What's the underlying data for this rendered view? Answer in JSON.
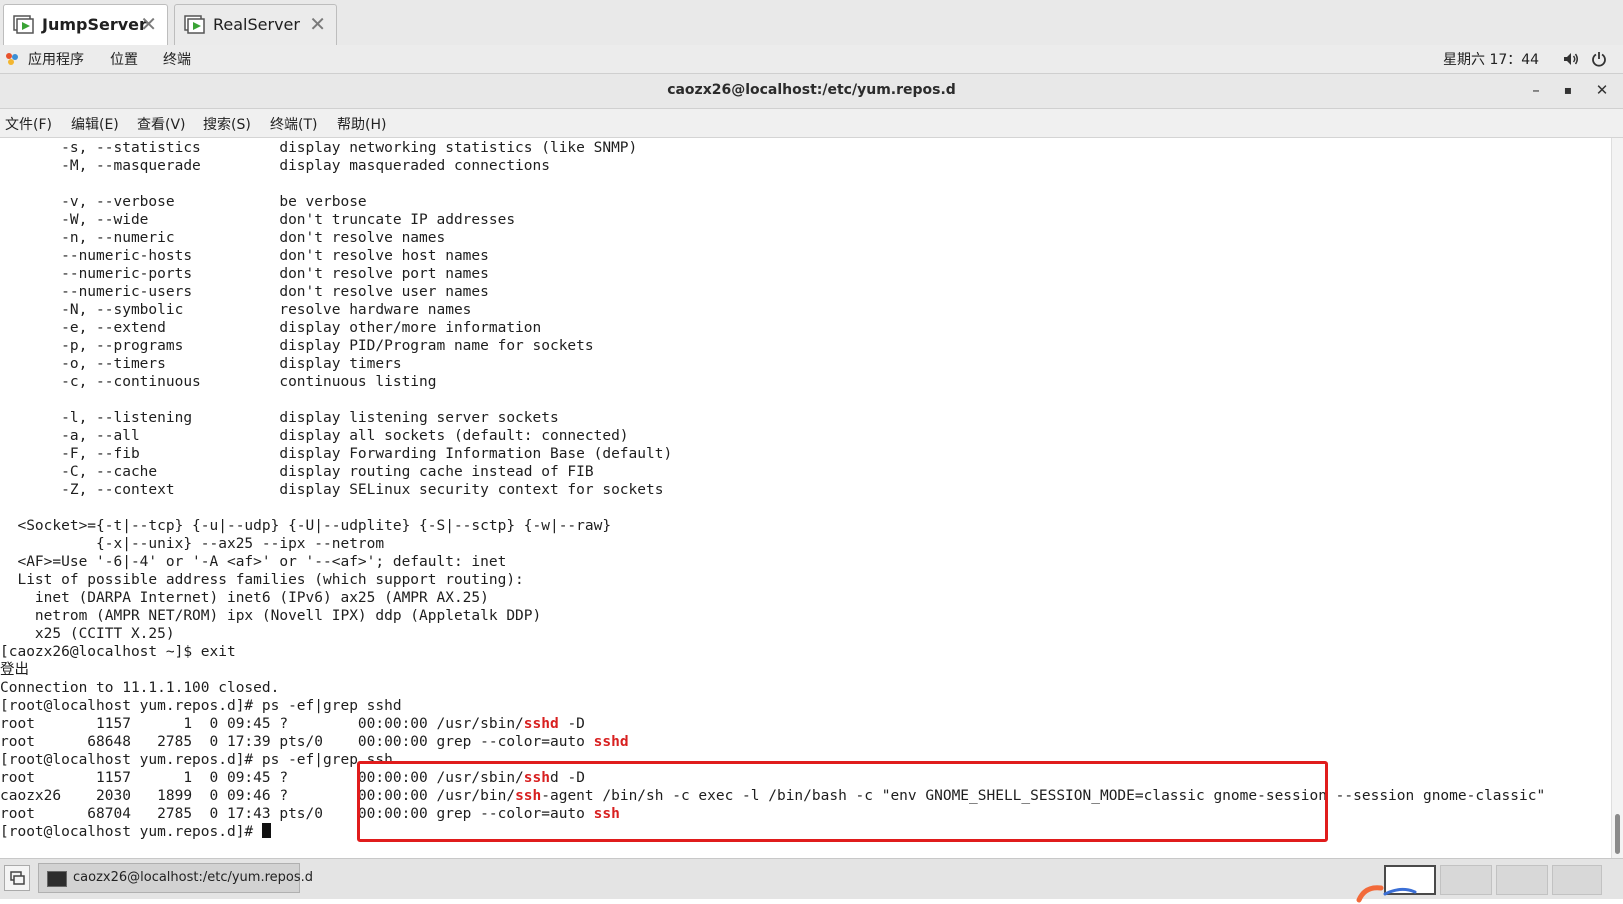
{
  "vm_tabs": [
    {
      "label": "JumpServer",
      "close": "✕"
    },
    {
      "label": "RealServer",
      "close": "✕"
    }
  ],
  "gnome_panel": {
    "menus": [
      "应用程序",
      "位置",
      "终端"
    ],
    "clock": "星期六 17：44",
    "icons": [
      "applications-icon",
      "volume-icon",
      "power-icon"
    ]
  },
  "window": {
    "title": "caozx26@localhost:/etc/yum.repos.d",
    "minimize": "–",
    "maximize": "▪",
    "close": "✕"
  },
  "terminal_menu": [
    "文件(F)",
    "编辑(E)",
    "查看(V)",
    "搜索(S)",
    "终端(T)",
    "帮助(H)"
  ],
  "terminal": {
    "lines": [
      {
        "t": "       -s, --statistics         display networking statistics (like SNMP)"
      },
      {
        "t": "       -M, --masquerade         display masqueraded connections"
      },
      {
        "t": ""
      },
      {
        "t": "       -v, --verbose            be verbose"
      },
      {
        "t": "       -W, --wide               don't truncate IP addresses"
      },
      {
        "t": "       -n, --numeric            don't resolve names"
      },
      {
        "t": "       --numeric-hosts          don't resolve host names"
      },
      {
        "t": "       --numeric-ports          don't resolve port names"
      },
      {
        "t": "       --numeric-users          don't resolve user names"
      },
      {
        "t": "       -N, --symbolic           resolve hardware names"
      },
      {
        "t": "       -e, --extend             display other/more information"
      },
      {
        "t": "       -p, --programs           display PID/Program name for sockets"
      },
      {
        "t": "       -o, --timers             display timers"
      },
      {
        "t": "       -c, --continuous         continuous listing"
      },
      {
        "t": ""
      },
      {
        "t": "       -l, --listening          display listening server sockets"
      },
      {
        "t": "       -a, --all                display all sockets (default: connected)"
      },
      {
        "t": "       -F, --fib                display Forwarding Information Base (default)"
      },
      {
        "t": "       -C, --cache              display routing cache instead of FIB"
      },
      {
        "t": "       -Z, --context            display SELinux security context for sockets"
      },
      {
        "t": ""
      },
      {
        "t": "  <Socket>={-t|--tcp} {-u|--udp} {-U|--udplite} {-S|--sctp} {-w|--raw}"
      },
      {
        "t": "           {-x|--unix} --ax25 --ipx --netrom"
      },
      {
        "t": "  <AF>=Use '-6|-4' or '-A <af>' or '--<af>'; default: inet"
      },
      {
        "t": "  List of possible address families (which support routing):"
      },
      {
        "t": "    inet (DARPA Internet) inet6 (IPv6) ax25 (AMPR AX.25)"
      },
      {
        "t": "    netrom (AMPR NET/ROM) ipx (Novell IPX) ddp (Appletalk DDP)"
      },
      {
        "t": "    x25 (CCITT X.25)"
      },
      {
        "t": "[caozx26@localhost ~]$ exit"
      },
      {
        "t": "登出"
      },
      {
        "t": "Connection to 11.1.1.100 closed."
      },
      {
        "t": "[root@localhost yum.repos.d]# ps -ef|grep sshd"
      },
      {
        "t": "root       1157      1  0 09:45 ?        00:00:00 /usr/sbin/",
        "h": "sshd",
        "a": " -D"
      },
      {
        "t": "root      68648   2785  0 17:39 pts/0    00:00:00 grep --color=auto ",
        "h": "sshd",
        "a": ""
      },
      {
        "t": "[root@localhost yum.repos.d]# ps -ef|grep ssh"
      },
      {
        "t": "root       1157      1  0 09:45 ?        00:00:00 /usr/sbin/",
        "h": "ssh",
        "a": "d -D"
      },
      {
        "t": "caozx26    2030   1899  0 09:46 ?        00:00:00 /usr/bin/",
        "h": "ssh",
        "a": "-agent /bin/sh -c exec -l /bin/bash -c \"env GNOME_SHELL_SESSION_MODE=classic gnome-session --session gnome-classic\""
      },
      {
        "t": "root      68704   2785  0 17:43 pts/0    00:00:00 grep --color=auto ",
        "h": "ssh",
        "a": ""
      },
      {
        "t": "[root@localhost yum.repos.d]# ",
        "cursor": true
      }
    ]
  },
  "taskbar": {
    "task_label": "caozx26@localhost:/etc/yum.repos.d",
    "workspaces": 4,
    "active_workspace": 1
  },
  "colors": {
    "highlight_box": "#e01c1c",
    "match_text": "#d82020",
    "terminal_bg": "#ffffff",
    "terminal_fg": "#1e1e1e"
  }
}
